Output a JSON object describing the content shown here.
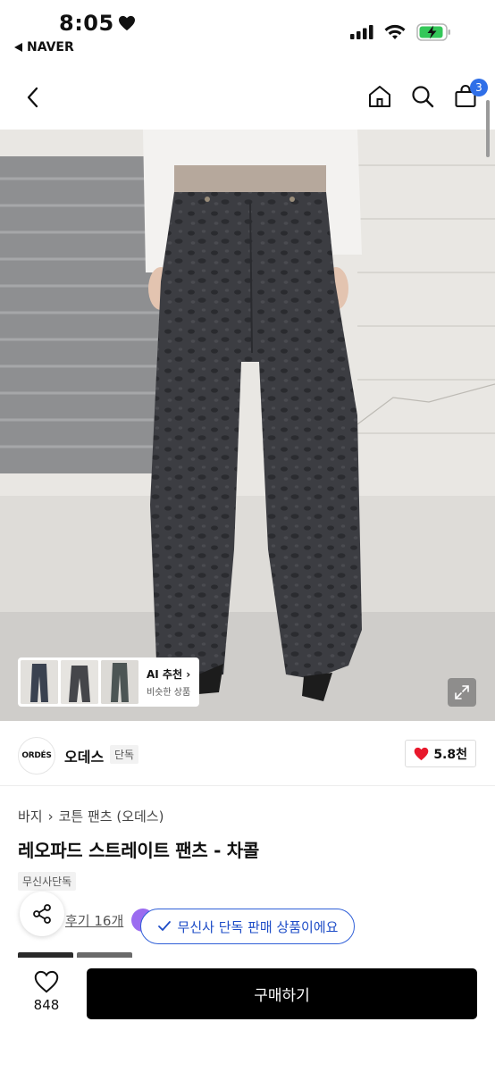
{
  "status_bar": {
    "time": "8:05",
    "back_app": "NAVER"
  },
  "nav": {
    "cart_count": "3"
  },
  "hero": {
    "ai_title": "AI 추천 ›",
    "ai_subtitle": "비슷한 상품"
  },
  "brand": {
    "logo_text": "ORDÉS",
    "name": "오데스",
    "tag": "단독",
    "likes": "5.8천"
  },
  "product": {
    "breadcrumb": [
      "바지",
      "코튼 팬츠 (오데스)"
    ],
    "breadcrumb_separator": "›",
    "title": "레오파드 스트레이트 팬츠 - 차콜",
    "exclusive_tag": "무신사단독",
    "review_link": "후기 16개"
  },
  "toast": {
    "message": "무신사 단독 판매 상품이에요"
  },
  "bottom_bar": {
    "wish_count": "848",
    "buy_label": "구매하기"
  },
  "colors": {
    "accent_blue": "#2f6fe8",
    "toast_blue": "#1d4cc7",
    "heart_red": "#e8182c",
    "button_black": "#000000",
    "battery_green": "#34c759"
  }
}
